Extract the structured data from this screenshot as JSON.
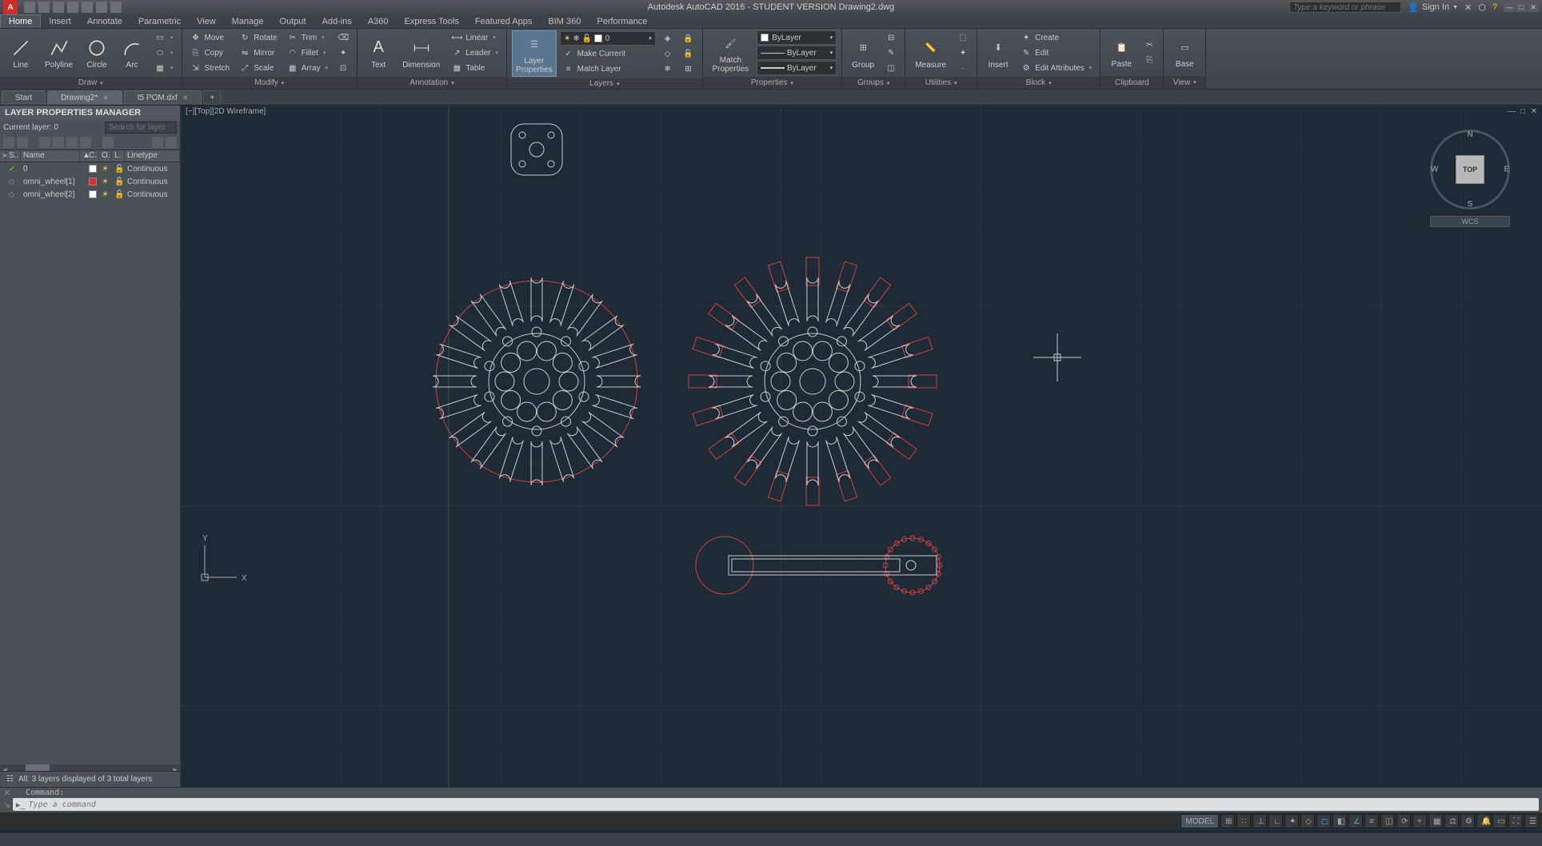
{
  "title": "Autodesk AutoCAD 2016 - STUDENT VERSION    Drawing2.dwg",
  "search_placeholder": "Type a keyword or phrase",
  "sign_in": "Sign In",
  "menu": [
    "Home",
    "Insert",
    "Annotate",
    "Parametric",
    "View",
    "Manage",
    "Output",
    "Add-ins",
    "A360",
    "Express Tools",
    "Featured Apps",
    "BIM 360",
    "Performance"
  ],
  "active_menu": "Home",
  "ribbon": {
    "draw": {
      "label": "Draw",
      "line": "Line",
      "polyline": "Polyline",
      "circle": "Circle",
      "arc": "Arc"
    },
    "modify": {
      "label": "Modify",
      "move": "Move",
      "copy": "Copy",
      "stretch": "Stretch",
      "rotate": "Rotate",
      "mirror": "Mirror",
      "scale": "Scale",
      "trim": "Trim",
      "fillet": "Fillet",
      "array": "Array"
    },
    "annotation": {
      "label": "Annotation",
      "text": "Text",
      "dimension": "Dimension",
      "linear": "Linear",
      "leader": "Leader",
      "table": "Table"
    },
    "layers": {
      "label": "Layers",
      "layer_properties": "Layer\nProperties",
      "make_current": "Make Current",
      "match_layer": "Match Layer",
      "selector": "0"
    },
    "properties": {
      "label": "Properties",
      "match": "Match\nProperties",
      "bylayer": "ByLayer"
    },
    "groups": {
      "label": "Groups",
      "group": "Group"
    },
    "utilities": {
      "label": "Utilities",
      "measure": "Measure"
    },
    "block": {
      "label": "Block",
      "insert": "Insert",
      "create": "Create",
      "edit": "Edit",
      "edit_attr": "Edit Attributes"
    },
    "clipboard": {
      "label": "Clipboard",
      "paste": "Paste"
    },
    "view": {
      "label": "View",
      "base": "Base"
    }
  },
  "doc_tabs": [
    {
      "label": "Start",
      "active": false,
      "closeable": false
    },
    {
      "label": "Drawing2*",
      "active": true,
      "closeable": true
    },
    {
      "label": "t5 POM.dxf",
      "active": false,
      "closeable": true
    }
  ],
  "layer_panel": {
    "title": "LAYER PROPERTIES MANAGER",
    "current": "Current layer: 0",
    "search_placeholder": "Search for layer",
    "columns": [
      "S..",
      "Name",
      "C.",
      "O.",
      "L.",
      "Linetype"
    ],
    "rows": [
      {
        "status": "✓",
        "name": "0",
        "color": "#ffffff",
        "on": "☀",
        "lock": "🔓",
        "linetype": "Continuous"
      },
      {
        "status": "—",
        "name": "omni_wheel[1]",
        "color": "#e03030",
        "on": "☀",
        "lock": "🔓",
        "linetype": "Continuous"
      },
      {
        "status": "—",
        "name": "omni_wheel[2]",
        "color": "#ffffff",
        "on": "☀",
        "lock": "🔓",
        "linetype": "Continuous"
      }
    ],
    "footer": "All: 3 layers displayed of 3 total layers"
  },
  "viewport_label": "[−][Top][2D Wireframe]",
  "viewcube": {
    "face": "TOP",
    "wcs": "WCS",
    "n": "N",
    "s": "S",
    "e": "E",
    "w": "W"
  },
  "command": {
    "history": "Command:",
    "placeholder": "Type a command"
  },
  "status": {
    "model": "MODEL"
  }
}
